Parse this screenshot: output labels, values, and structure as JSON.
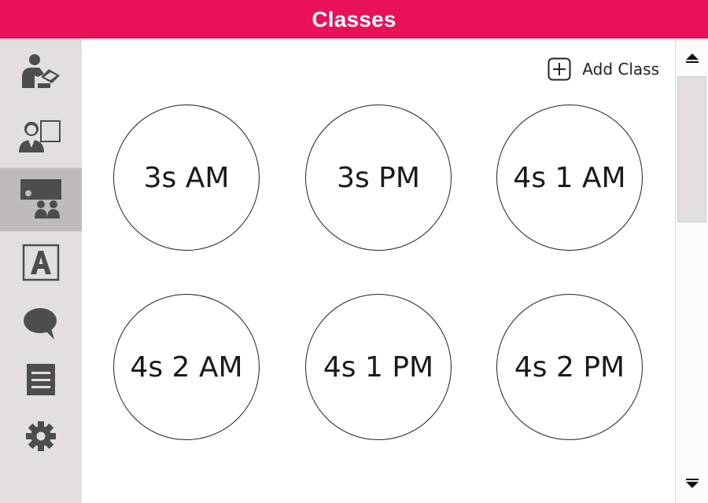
{
  "header": {
    "title": "Classes"
  },
  "sidebar": {
    "items": [
      {
        "icon": "teacher-reading-icon",
        "active": false
      },
      {
        "icon": "teacher-board-icon",
        "active": false
      },
      {
        "icon": "classroom-icon",
        "active": true
      },
      {
        "icon": "letter-a-icon",
        "active": false
      },
      {
        "icon": "speech-bubble-icon",
        "active": false
      },
      {
        "icon": "list-icon",
        "active": false
      },
      {
        "icon": "gear-icon",
        "active": false
      }
    ]
  },
  "main": {
    "add_class_label": "Add Class",
    "classes": [
      "3s AM",
      "3s PM",
      "4s 1 AM",
      "4s 2 AM",
      "4s 1 PM",
      "4s 2 PM"
    ]
  },
  "colors": {
    "header": "#e8115a",
    "sidebar": "#e3dfe1",
    "sidebar_active": "#bfbbbd",
    "icon": "#4d4d4d"
  }
}
